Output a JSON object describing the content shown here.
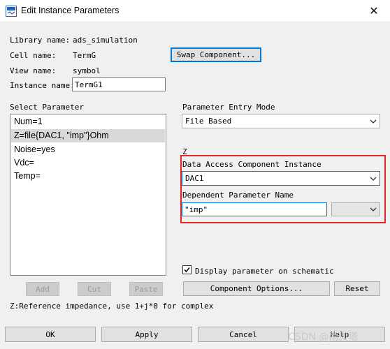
{
  "window": {
    "title": "Edit Instance Parameters"
  },
  "info": {
    "library_label": "Library name:",
    "library_value": "ads_simulation",
    "cell_label": "Cell name:",
    "cell_value": "TermG",
    "view_label": "View name:",
    "view_value": "symbol",
    "instance_label": "Instance name:",
    "instance_value": "TermG1"
  },
  "swap_button": "Swap Component...",
  "select_parameter": {
    "label": "Select Parameter",
    "items": [
      "Num=1",
      "Z=file{DAC1, \"imp\"}Ohm",
      "Noise=yes",
      "Vdc=",
      "Temp="
    ],
    "selected_index": 1
  },
  "list_buttons": {
    "add": "Add",
    "cut": "Cut",
    "paste": "Paste"
  },
  "entry_mode": {
    "label": "Parameter Entry Mode",
    "value": "File Based"
  },
  "param_name": "Z",
  "dac": {
    "label": "Data Access Component Instance",
    "value": "DAC1"
  },
  "dependent": {
    "label": "Dependent Parameter Name",
    "value": "\"imp\"",
    "unit_value": ""
  },
  "display_checkbox": {
    "label": "Display parameter on schematic",
    "checked": true
  },
  "component_options_button": "Component Options...",
  "reset_button": "Reset",
  "help_text": "Z:Reference impedance, use 1+j*0 for complex",
  "footer_buttons": {
    "ok": "OK",
    "apply": "Apply",
    "cancel": "Cancel",
    "help": "Help"
  },
  "watermark": "CSDN @南贝塔",
  "colors": {
    "highlight": "#e5252a",
    "focus": "#0078d7",
    "selection": "#d9d9d9"
  }
}
